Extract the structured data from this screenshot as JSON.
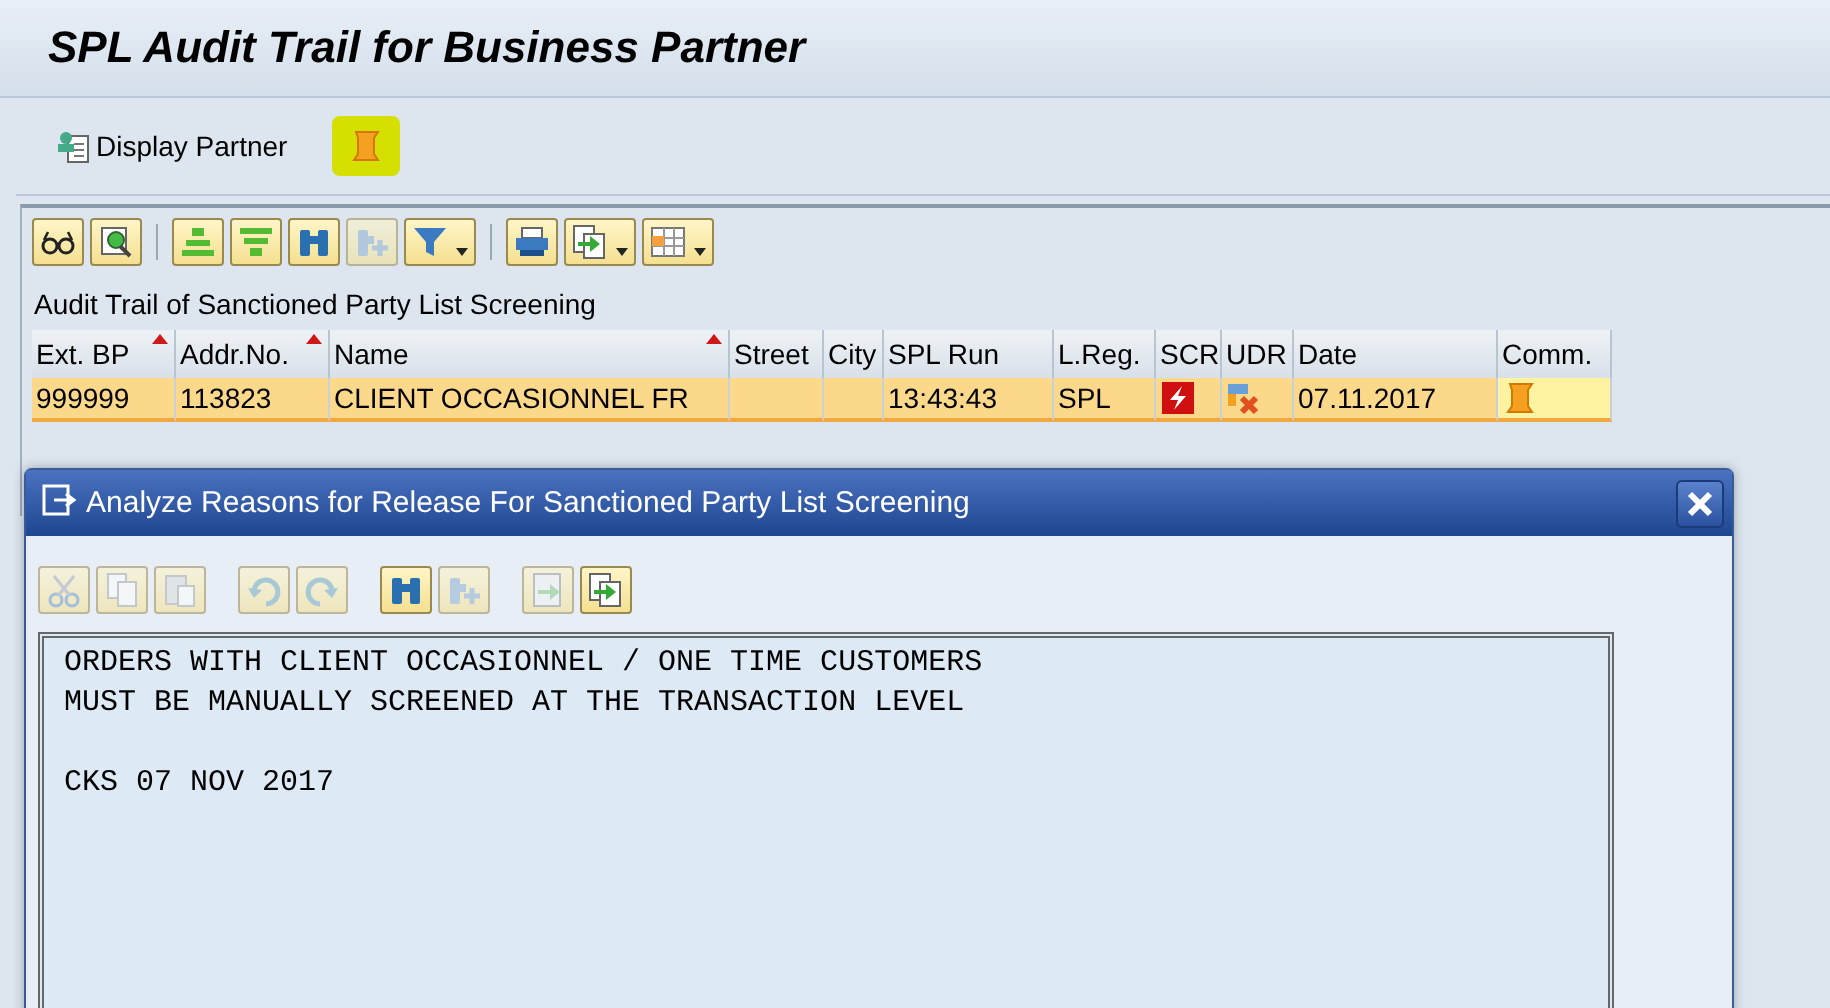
{
  "window": {
    "title": "SPL Audit Trail for Business Partner"
  },
  "app_toolbar": [
    {
      "kind": "person",
      "label": "Display Partner",
      "highlighted": false
    },
    {
      "kind": "scroll",
      "highlighted": true
    }
  ],
  "grid_toolbar": [
    [
      {
        "kind": "glasses",
        "disabled": false,
        "dropdown": false
      },
      {
        "kind": "detail",
        "disabled": false,
        "dropdown": false
      }
    ],
    [
      {
        "kind": "sort-up",
        "disabled": false,
        "dropdown": false
      },
      {
        "kind": "sort-down",
        "disabled": false,
        "dropdown": false
      },
      {
        "kind": "find",
        "disabled": false,
        "dropdown": false
      },
      {
        "kind": "find-next",
        "disabled": true,
        "dropdown": false
      },
      {
        "kind": "filter",
        "disabled": false,
        "dropdown": true
      }
    ],
    [
      {
        "kind": "print",
        "disabled": false,
        "dropdown": false
      },
      {
        "kind": "export",
        "disabled": false,
        "dropdown": true
      },
      {
        "kind": "layout",
        "disabled": false,
        "dropdown": true
      }
    ]
  ],
  "table": {
    "title": "Audit Trail of Sanctioned Party List Screening",
    "columns": [
      {
        "label": "Ext. BP",
        "sorted": true
      },
      {
        "label": "Addr.No.",
        "sorted": true
      },
      {
        "label": "Name",
        "sorted": true
      },
      {
        "label": "Street",
        "sorted": false
      },
      {
        "label": "City",
        "sorted": false
      },
      {
        "label": "SPL Run",
        "sorted": false
      },
      {
        "label": "L.Reg.",
        "sorted": false
      },
      {
        "label": "SCR",
        "sorted": false
      },
      {
        "label": "UDR",
        "sorted": false
      },
      {
        "label": "Date",
        "sorted": false
      },
      {
        "label": "Comm.",
        "sorted": false
      }
    ],
    "rows": [
      {
        "selected": true,
        "cells": [
          {
            "kind": "text",
            "text": "999999"
          },
          {
            "kind": "text",
            "text": "113823"
          },
          {
            "kind": "text",
            "text": "CLIENT OCCASIONNEL FR"
          },
          {
            "kind": "empty"
          },
          {
            "kind": "empty"
          },
          {
            "kind": "text",
            "text": "13:43:43"
          },
          {
            "kind": "text",
            "text": "SPL"
          },
          {
            "kind": "alert"
          },
          {
            "kind": "reject"
          },
          {
            "kind": "text",
            "text": "07.11.2017"
          },
          {
            "kind": "comment"
          }
        ]
      }
    ]
  },
  "dialog": {
    "title": "Analyze Reasons for Release For Sanctioned Party List Screening",
    "toolbar": [
      [
        {
          "kind": "cut",
          "disabled": true
        },
        {
          "kind": "copy",
          "disabled": true
        },
        {
          "kind": "paste",
          "disabled": true
        }
      ],
      [
        {
          "kind": "undo",
          "disabled": true
        },
        {
          "kind": "redo",
          "disabled": true
        }
      ],
      [
        {
          "kind": "find",
          "disabled": false
        },
        {
          "kind": "find-next",
          "disabled": true
        }
      ],
      [
        {
          "kind": "import",
          "disabled": true
        },
        {
          "kind": "export",
          "disabled": false
        }
      ]
    ],
    "paragraphs": [
      [
        "ORDERS WITH CLIENT OCCASIONNEL / ONE TIME CUSTOMERS",
        "MUST BE MANUALLY SCREENED AT THE TRANSACTION LEVEL"
      ],
      [
        "CKS 07 NOV 2017"
      ]
    ]
  }
}
